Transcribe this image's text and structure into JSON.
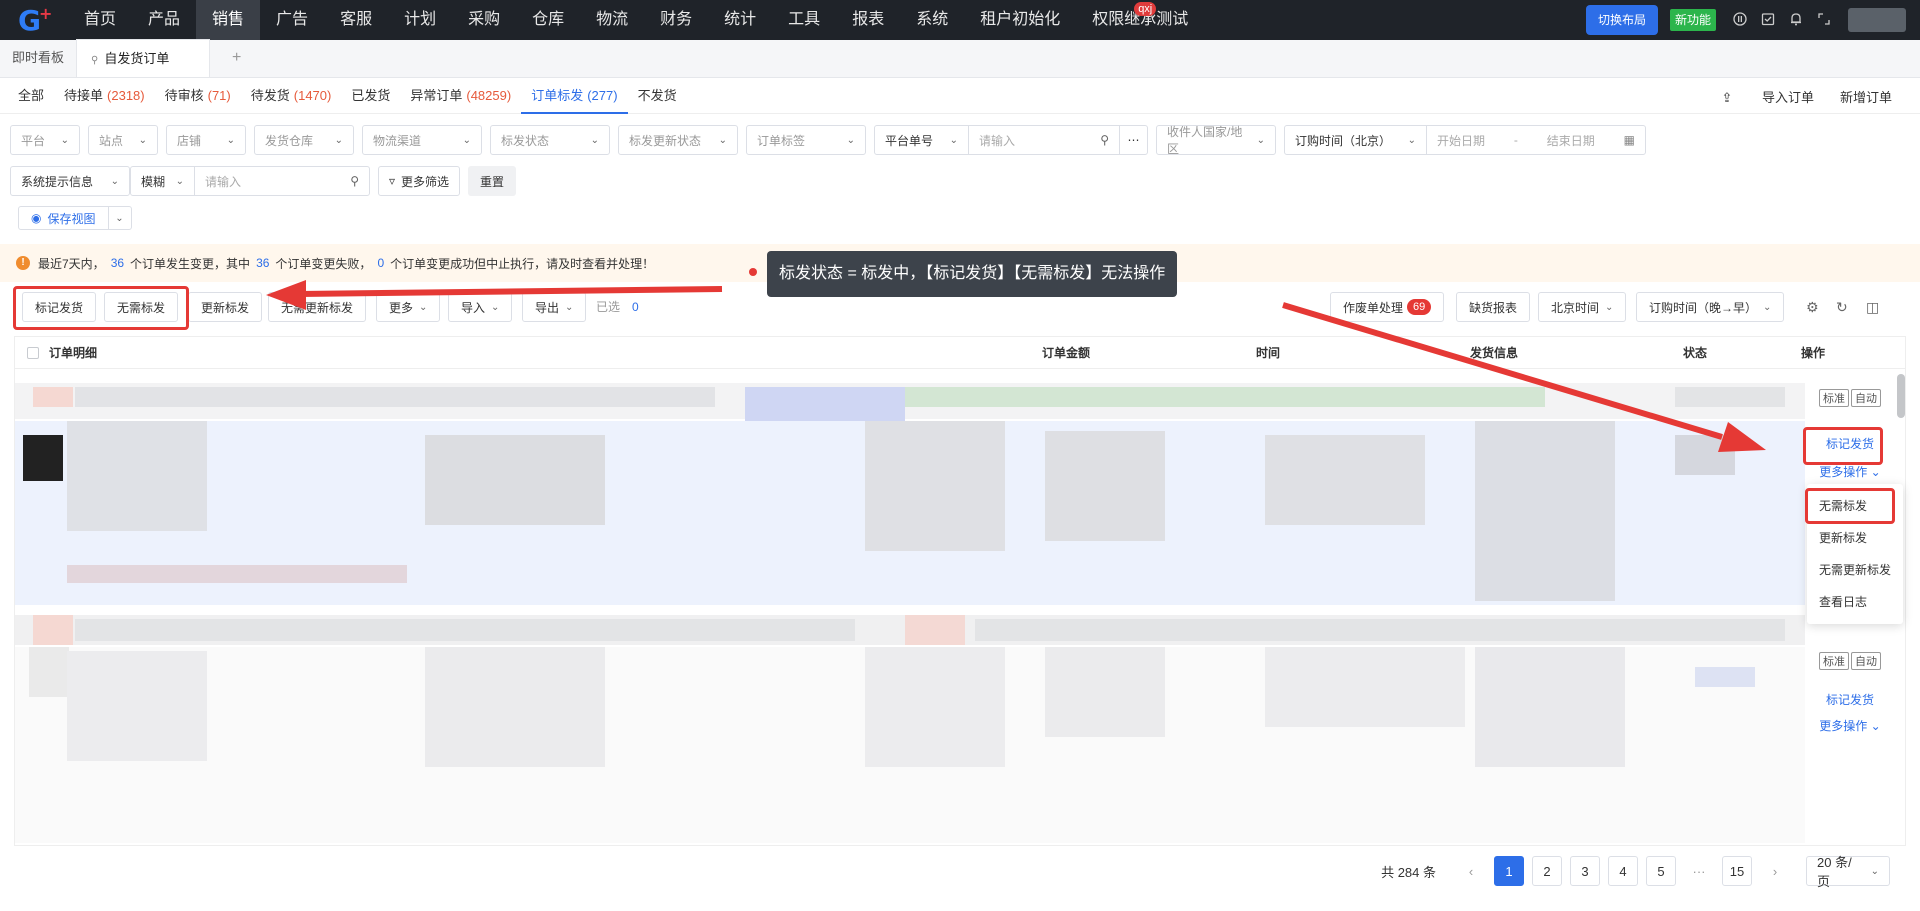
{
  "nav": {
    "items": [
      "首页",
      "产品",
      "销售",
      "广告",
      "客服",
      "计划",
      "采购",
      "仓库",
      "物流",
      "财务",
      "统计",
      "工具",
      "报表",
      "系统",
      "租户初始化",
      "权限继承测试"
    ],
    "active_index": 2,
    "badge": "qxj",
    "switch_layout": "切换布局",
    "new_feature": "新功能"
  },
  "page_tabs": {
    "dashboard": "即时看板",
    "current": "自发货订单",
    "add": "+"
  },
  "subtabs": [
    {
      "label": "全部",
      "count": ""
    },
    {
      "label": "待接单",
      "count": "(2318)"
    },
    {
      "label": "待审核",
      "count": "(71)"
    },
    {
      "label": "待发货",
      "count": "(1470)"
    },
    {
      "label": "已发货",
      "count": ""
    },
    {
      "label": "异常订单",
      "count": "(48259)"
    },
    {
      "label": "订单标发",
      "count": "(277)"
    },
    {
      "label": "不发货",
      "count": ""
    }
  ],
  "subtab_actions": {
    "import": "导入订单",
    "add": "新增订单"
  },
  "filters": {
    "platform": "平台",
    "site": "站点",
    "store": "店铺",
    "warehouse": "发货仓库",
    "logistics": "物流渠道",
    "mark_status": "标发状态",
    "mark_update_status": "标发更新状态",
    "order_tag": "订单标签",
    "platform_no": "平台单号",
    "input_placeholder": "请输入",
    "recipient_country": "收件人国家/地区",
    "order_time": "订购时间（北京）",
    "start_date": "开始日期",
    "date_sep": "-",
    "end_date": "结束日期",
    "sys_info": "系统提示信息",
    "fuzzy": "模糊",
    "more_filter": "更多筛选",
    "reset": "重置",
    "save_view": "保存视图"
  },
  "notice": {
    "p1": "最近7天内，",
    "n1": "36",
    "p2": "个订单发生变更，其中",
    "n2": "36",
    "p3": "个订单变更失败，",
    "n3": "0",
    "p4": "个订单变更成功但中止执行，请及时查看并处理！"
  },
  "callout": "标发状态 = 标发中，【标记发货】【无需标发】无法操作",
  "toolbar": {
    "mark_ship": "标记发货",
    "no_mark": "无需标发",
    "update_mark": "更新标发",
    "no_update_mark": "无需更新标发",
    "more": "更多",
    "import": "导入",
    "export": "导出",
    "selected": "已选",
    "selected_count": "0",
    "void_handle": "作废单处理",
    "void_count": "69",
    "stock_report": "缺货报表",
    "beijing_time": "北京时间",
    "order_time_sort": "订购时间（晚→早）"
  },
  "table": {
    "headers": [
      "订单明细",
      "订单金额",
      "时间",
      "发货信息",
      "状态",
      "操作"
    ],
    "row_tags": [
      "标准",
      "自动"
    ],
    "op_mark_ship": "标记发货",
    "op_more": "更多操作"
  },
  "dropdown": [
    "无需标发",
    "更新标发",
    "无需更新标发",
    "查看日志"
  ],
  "pager": {
    "total": "共 284 条",
    "pages": [
      "1",
      "2",
      "3",
      "4",
      "5"
    ],
    "ellipsis": "···",
    "last": "15",
    "size": "20 条/页"
  },
  "colors": {
    "accent": "#2d6ee8",
    "annotation_red": "#e53935",
    "count_orange": "#e65a3b"
  }
}
